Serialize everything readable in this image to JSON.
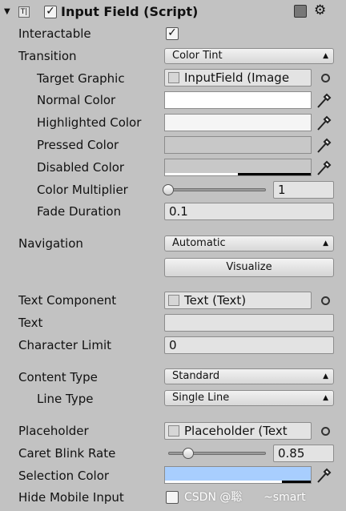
{
  "header": {
    "title": "Input Field (Script)",
    "enabled": true
  },
  "rows": {
    "interactable": {
      "label": "Interactable",
      "checked": true
    },
    "transition": {
      "label": "Transition",
      "value": "Color Tint"
    },
    "target_graphic": {
      "label": "Target Graphic",
      "value": "InputField (Image"
    },
    "normal_color": {
      "label": "Normal Color",
      "color": "#ffffff"
    },
    "highlighted_color": {
      "label": "Highlighted Color",
      "color": "#f5f5f5"
    },
    "pressed_color": {
      "label": "Pressed Color",
      "color": "#c8c8c8"
    },
    "disabled_color": {
      "label": "Disabled Color",
      "color": "#c8c8c8",
      "alpha": 0.5
    },
    "color_multiplier": {
      "label": "Color Multiplier",
      "value": "1",
      "fraction": 0.0
    },
    "fade_duration": {
      "label": "Fade Duration",
      "value": "0.1"
    },
    "navigation": {
      "label": "Navigation",
      "value": "Automatic"
    },
    "visualize": {
      "label": "Visualize"
    },
    "text_component": {
      "label": "Text Component",
      "value": "Text (Text)"
    },
    "text": {
      "label": "Text",
      "value": ""
    },
    "character_limit": {
      "label": "Character Limit",
      "value": "0"
    },
    "content_type": {
      "label": "Content Type",
      "value": "Standard"
    },
    "line_type": {
      "label": "Line Type",
      "value": "Single Line"
    },
    "placeholder": {
      "label": "Placeholder",
      "value": "Placeholder (Text"
    },
    "caret_blink_rate": {
      "label": "Caret Blink Rate",
      "value": "0.85",
      "fraction": 0.2
    },
    "selection_color": {
      "label": "Selection Color",
      "color": "#a8cefe"
    },
    "hide_mobile_input": {
      "label": "Hide Mobile Input",
      "checked": false
    }
  },
  "watermark": "CSDN @聡      ~smart"
}
